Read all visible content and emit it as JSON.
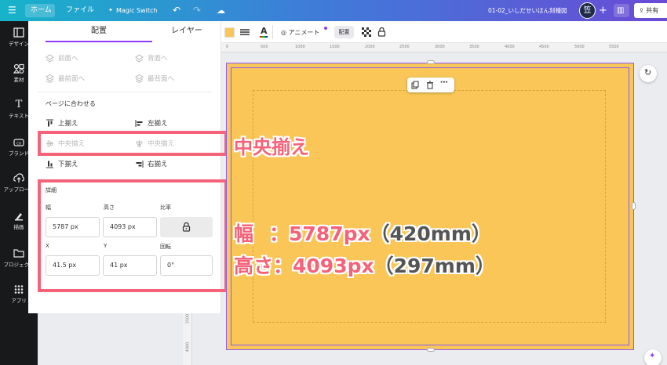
{
  "topbar": {
    "menu_icon": "hamburger-icon",
    "home": "ホーム",
    "file": "ファイル",
    "magic_switch": "Magic Switch",
    "doc_title": "01-02_いしだせいほん刻種図",
    "avatar_initial": "笠",
    "share": "共有"
  },
  "rail": {
    "items": [
      {
        "label": "デザイン",
        "icon": "layout-icon"
      },
      {
        "label": "素材",
        "icon": "shapes-icon"
      },
      {
        "label": "テキスト",
        "icon": "text-icon"
      },
      {
        "label": "ブランド",
        "icon": "brand-icon"
      },
      {
        "label": "アップロード",
        "icon": "upload-icon"
      },
      {
        "label": "描画",
        "icon": "draw-icon"
      },
      {
        "label": "プロジェクト",
        "icon": "folder-icon"
      },
      {
        "label": "アプリ",
        "icon": "apps-icon"
      }
    ]
  },
  "panel": {
    "tabs": [
      "配置",
      "レイヤー"
    ],
    "order": {
      "forward": "前面へ",
      "backward": "背面へ",
      "front": "最前面へ",
      "back": "最背面へ"
    },
    "align_title": "ページに合わせる",
    "align": {
      "top": "上揃え",
      "left": "左揃え",
      "middle": "中央揃え",
      "center": "中央揃え",
      "bottom": "下揃え",
      "right": "右揃え"
    },
    "detail_title": "詳細",
    "width_label": "幅",
    "height_label": "高さ",
    "ratio_label": "比率",
    "width_value": "5787 px",
    "height_value": "4093 px",
    "x_label": "X",
    "y_label": "Y",
    "rotate_label": "回転",
    "x_value": "41.5 px",
    "y_value": "41 px",
    "rotate_value": "0°"
  },
  "toolbar": {
    "animate": "アニメート",
    "position": "配置"
  },
  "ruler": {
    "top_ticks": [
      "0",
      "500",
      "1000",
      "1500",
      "2000",
      "2500",
      "3000",
      "3500",
      "4000",
      "4500",
      "5000",
      "5500"
    ],
    "left_ticks": [
      "3500",
      "4000"
    ]
  },
  "annotations": {
    "center_align": "中央揃え",
    "width_line_label": "幅",
    "width_line_value": "：5787px",
    "width_line_mm": "（420mm）",
    "height_line_label": "高さ",
    "height_line_value": "：4093px",
    "height_line_mm": "（297mm）"
  },
  "colors": {
    "page": "#f9c657",
    "accent": "#8b3dff",
    "highlight": "#f4637a"
  }
}
